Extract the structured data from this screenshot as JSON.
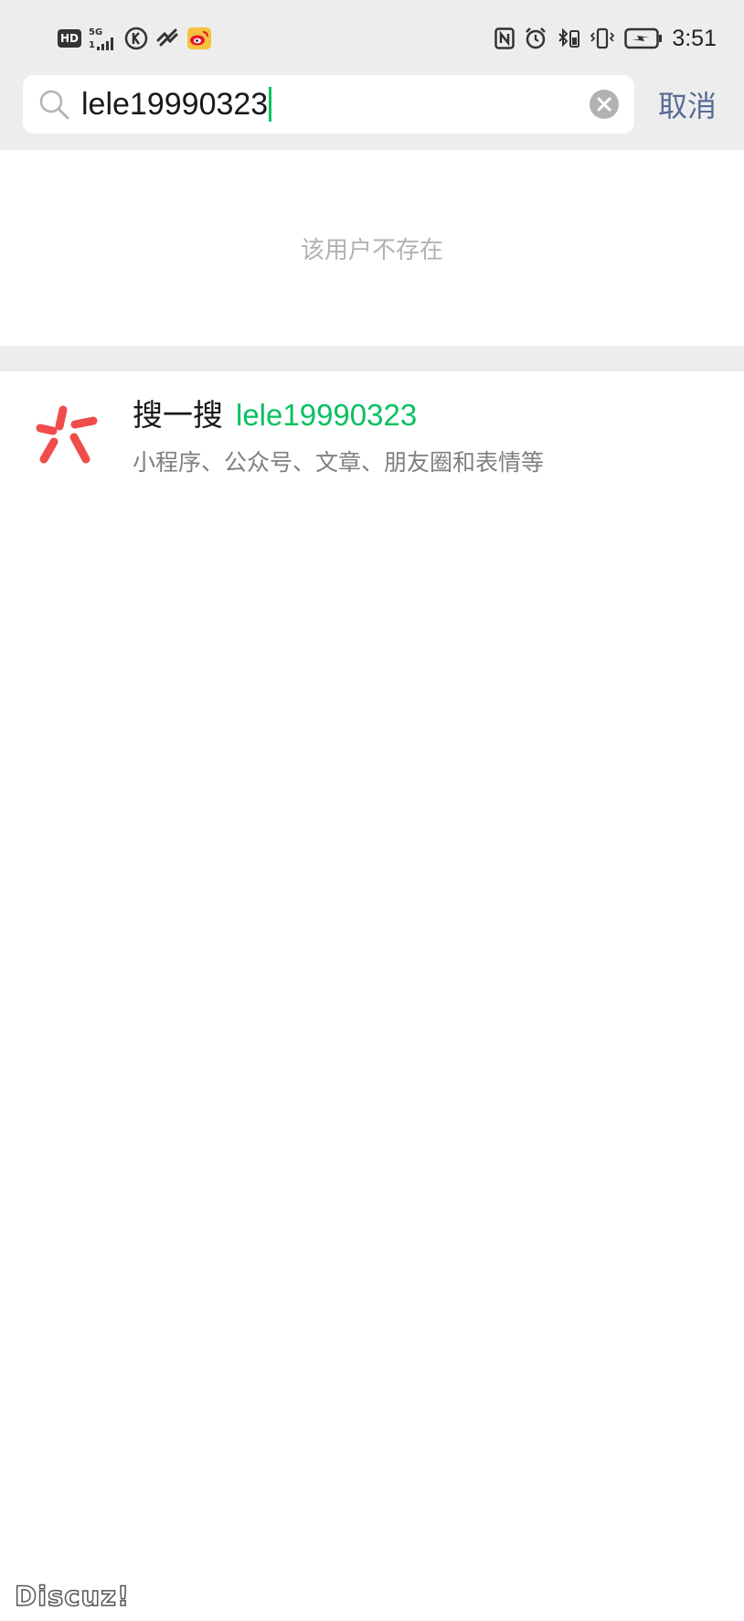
{
  "status_bar": {
    "hd_label": "HD",
    "network_label": "5G",
    "network_sub": "1",
    "time": "3:51",
    "icons_left": [
      "hd-icon",
      "signal-5g-icon",
      "kuwo-icon",
      "app-icon",
      "weibo-icon"
    ],
    "icons_right": [
      "nfc-icon",
      "alarm-icon",
      "bluetooth-battery-icon",
      "vibrate-icon",
      "battery-charging-icon"
    ]
  },
  "search": {
    "query": "lele19990323",
    "cancel_label": "取消"
  },
  "result": {
    "not_found_text": "该用户不存在"
  },
  "sousou": {
    "label": "搜一搜",
    "keyword": "lele19990323",
    "subtitle": "小程序、公众号、文章、朋友圈和表情等"
  },
  "watermark": {
    "text": "Discuz!"
  },
  "colors": {
    "accent_green": "#07c160",
    "link_blue": "#576b95",
    "header_gray": "#ededed",
    "logo_red": "#f04c4c"
  }
}
